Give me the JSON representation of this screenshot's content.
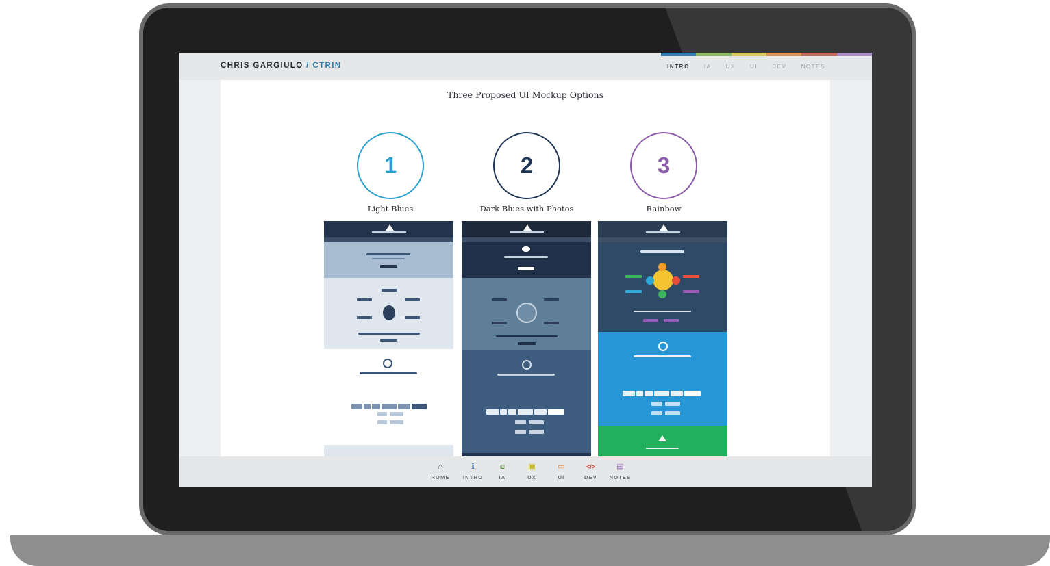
{
  "header": {
    "brand_name": "CHRIS GARGIULO",
    "brand_sep": "/",
    "brand_sub": "CTRIN",
    "nav": [
      {
        "label": "INTRO",
        "active": true
      },
      {
        "label": "IA",
        "active": false
      },
      {
        "label": "UX",
        "active": false
      },
      {
        "label": "UI",
        "active": false
      },
      {
        "label": "DEV",
        "active": false
      },
      {
        "label": "NOTES",
        "active": false
      }
    ],
    "strip_colors": [
      "#2f7fb5",
      "#8fb862",
      "#d6c95a",
      "#e0914e",
      "#c96a5e",
      "#a88cc4"
    ]
  },
  "main": {
    "heading": "Three Proposed UI Mockup Options",
    "options": [
      {
        "number": "1",
        "title": "Light Blues",
        "color": "#2aa0d0"
      },
      {
        "number": "2",
        "title": "Dark Blues with Photos",
        "color": "#1f3556"
      },
      {
        "number": "3",
        "title": "Rainbow",
        "color": "#8a5aa8"
      }
    ]
  },
  "footer": {
    "nav": [
      {
        "label": "HOME",
        "icon": "home-icon",
        "glyph": "⌂",
        "color": "#4a4f56"
      },
      {
        "label": "INTRO",
        "icon": "info-icon",
        "glyph": "i",
        "color": "#1f4f8a"
      },
      {
        "label": "IA",
        "icon": "sitemap-icon",
        "glyph": "⧈",
        "color": "#5a9a3a"
      },
      {
        "label": "UX",
        "icon": "wireframe-icon",
        "glyph": "▣",
        "color": "#c9b42a"
      },
      {
        "label": "UI",
        "icon": "browser-window-icon",
        "glyph": "▭",
        "color": "#e0833a"
      },
      {
        "label": "DEV",
        "icon": "code-icon",
        "glyph": "</>",
        "color": "#d0453a"
      },
      {
        "label": "NOTES",
        "icon": "clipboard-icon",
        "glyph": "▤",
        "color": "#9a6ab8"
      }
    ]
  }
}
